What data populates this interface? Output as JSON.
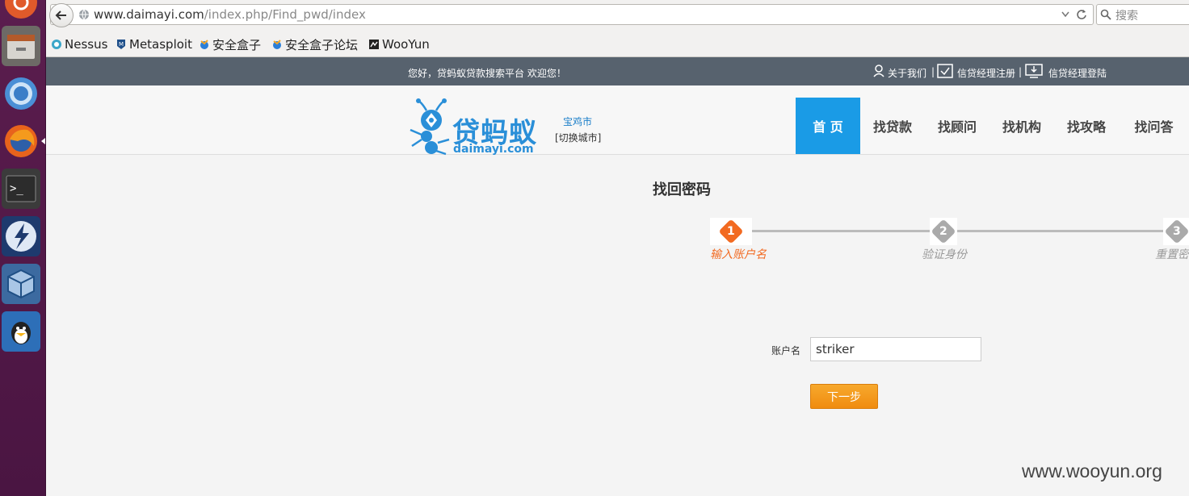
{
  "browser": {
    "url_domain": "www.daimayi.com",
    "url_path": "/index.php/Find_pwd/index",
    "search_placeholder": "搜索",
    "bookmarks": [
      {
        "label": "Nessus"
      },
      {
        "label": "Metasploit"
      },
      {
        "label": "安全盒子"
      },
      {
        "label": "安全盒子论坛"
      },
      {
        "label": "WooYun"
      }
    ]
  },
  "topbar": {
    "welcome": "您好，贷蚂蚁贷款搜索平台 欢迎您！",
    "about": "关于我们",
    "sep1": "|",
    "register": "信贷经理注册",
    "sep2": "|",
    "login": "信贷经理登陆"
  },
  "logo": {
    "cn": "贷蚂蚁",
    "en": "daimayi.com"
  },
  "city": {
    "name": "宝鸡市",
    "switch": "[切换城市]"
  },
  "nav": [
    {
      "label": "首 页",
      "active": true
    },
    {
      "label": "找贷款"
    },
    {
      "label": "找顾问"
    },
    {
      "label": "找机构"
    },
    {
      "label": "找攻略"
    },
    {
      "label": "找问答"
    }
  ],
  "form": {
    "title": "找回密码",
    "steps": [
      {
        "num": "1",
        "label": "输入账户名",
        "active": true
      },
      {
        "num": "2",
        "label": "验证身份"
      },
      {
        "num": "3",
        "label": "重置密"
      }
    ],
    "account_label": "账户名",
    "account_value": "striker",
    "next_button": "下一步"
  },
  "watermark": "www.wooyun.org",
  "colors": {
    "accent": "#1a9be6",
    "step_active": "#f26a21",
    "button": "#f59a1b",
    "topbar": "#57626e",
    "launcher": "#5b1d4e"
  }
}
